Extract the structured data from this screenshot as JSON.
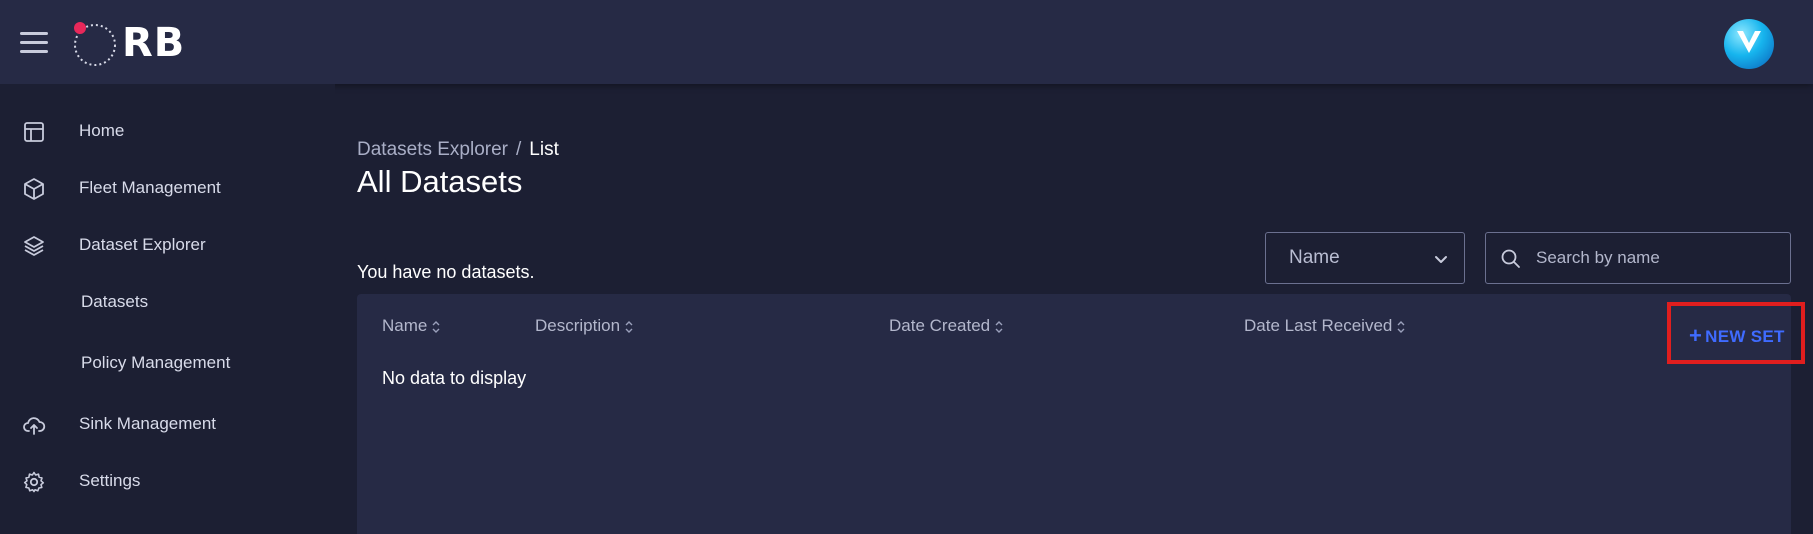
{
  "app": {
    "logo_text": "RB"
  },
  "sidebar": {
    "items": [
      {
        "label": "Home",
        "icon": "layout-icon"
      },
      {
        "label": "Fleet Management",
        "icon": "cube-icon"
      },
      {
        "label": "Dataset Explorer",
        "icon": "layers-icon"
      },
      {
        "label": "Datasets",
        "icon": ""
      },
      {
        "label": "Policy Management",
        "icon": ""
      },
      {
        "label": "Sink Management",
        "icon": "cloud-upload-icon"
      },
      {
        "label": "Settings",
        "icon": "gear-icon"
      }
    ]
  },
  "breadcrumb": {
    "parent": "Datasets Explorer",
    "separator": "/",
    "current": "List"
  },
  "page": {
    "title": "All Datasets",
    "empty_message": "You have no datasets."
  },
  "filters": {
    "sort_select": {
      "value": "Name"
    },
    "search": {
      "placeholder": "Search by name"
    }
  },
  "table": {
    "columns": [
      "Name",
      "Description",
      "Date Created",
      "Date Last Received"
    ],
    "new_button": {
      "plus": "+",
      "label": "NEW SET"
    },
    "empty_text": "No data to display"
  },
  "colors": {
    "accent": "#3f6bff",
    "highlight": "#e01e1e",
    "topbar": "#262a45",
    "background": "#1c1f33",
    "logo_dot": "#e8285a"
  }
}
